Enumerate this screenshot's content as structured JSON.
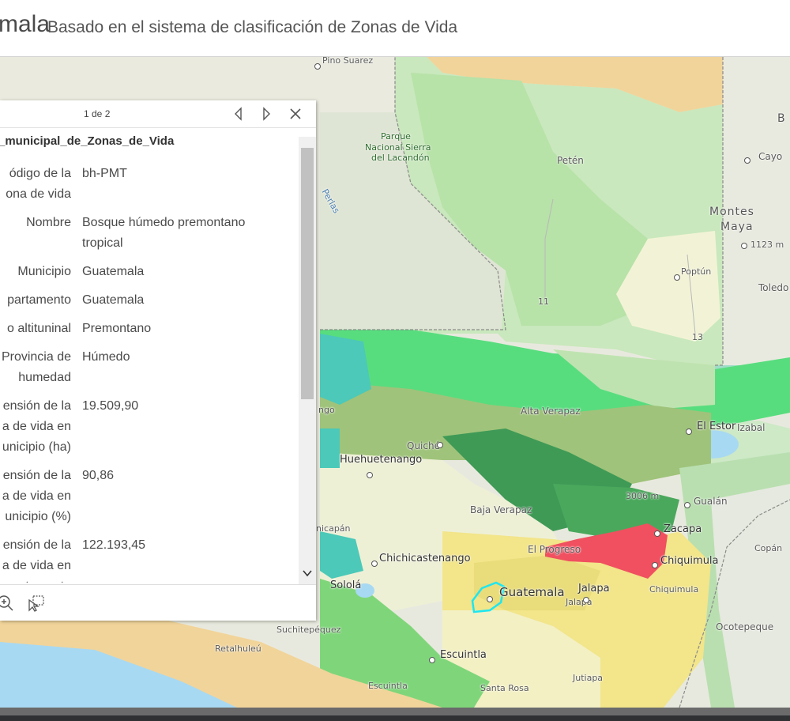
{
  "header": {
    "title": "mala",
    "subtitle": "Basado en el sistema de clasificación de Zonas de Vida"
  },
  "map": {
    "labels": {
      "pino_suarez": "Pino Suarez",
      "parque_1": "Parque",
      "parque_2": "Nacional Sierra",
      "parque_3": "del Lacandón",
      "peten": "Petén",
      "montes": "Montes",
      "maya": "Maya",
      "elev_1123": "1123 m",
      "poptun": "Poptún",
      "toledo": "Toledo",
      "cayo": "Cayo",
      "b": "B",
      "perlas": "Perlas",
      "route_11": "11",
      "route_13": "13",
      "alta_verapaz": "Alta Verapaz",
      "el_estor": "El Estor",
      "izabal": "Izabal",
      "ngo": "ngo",
      "quiche": "Quiché",
      "huehuetenango": "Huehuetenango",
      "elev_3006": "3006 m",
      "gualan": "Gualán",
      "baja_verapaz": "Baja Verapaz",
      "zacapa": "Zacapa",
      "nicapan": "nicapán",
      "el_progreso": "El Progreso",
      "chiquimula_city": "Chiquimula",
      "chichicastenango": "Chichicastenango",
      "copan": "Copán",
      "solola": "Sololá",
      "guatemala": "Guatemala",
      "jalapa_city": "Jalapa",
      "jalapa_dept": "Jalapa",
      "chiquimula_dept": "Chiquimula",
      "ocotepeque": "Ocotepeque",
      "suchitepequez": "Suchitepéquez",
      "retalhuleu": "Retalhuleú",
      "escuintla_city": "Escuintla",
      "escuintla_dept": "Escuintla",
      "jutiapa": "Jutiapa",
      "santa_rosa": "Santa Rosa"
    }
  },
  "popup": {
    "count": "1 de 2",
    "title": "_municipal_de_Zonas_de_Vida",
    "fields": [
      {
        "key_lines": [
          "ódigo de la",
          "ona de vida"
        ],
        "value_lines": [
          "bh-PMT"
        ]
      },
      {
        "key_lines": [
          "Nombre"
        ],
        "value_lines": [
          "Bosque húmedo premontano",
          "tropical"
        ]
      },
      {
        "key_lines": [
          "Municipio"
        ],
        "value_lines": [
          "Guatemala"
        ]
      },
      {
        "key_lines": [
          "partamento"
        ],
        "value_lines": [
          "Guatemala"
        ]
      },
      {
        "key_lines": [
          "o altituninal"
        ],
        "value_lines": [
          "Premontano"
        ]
      },
      {
        "key_lines": [
          "Provincia de",
          "humedad"
        ],
        "value_lines": [
          "Húmedo"
        ]
      },
      {
        "key_lines": [
          "ensión de la",
          "a de vida en",
          "unicipio (ha)"
        ],
        "value_lines": [
          "19.509,90"
        ]
      },
      {
        "key_lines": [
          "ensión de la",
          "a de vida en",
          "unicipio (%)"
        ],
        "value_lines": [
          "90,86"
        ]
      },
      {
        "key_lines": [
          "ensión de la",
          "a de vida en",
          "partamento"
        ],
        "value_lines": [
          "122.193,45"
        ]
      }
    ]
  },
  "icons": {
    "prev": "chevron-left-icon",
    "next": "chevron-right-icon",
    "close": "close-icon",
    "zoom": "zoom-in-icon",
    "select": "select-feature-icon",
    "filter": "filter-icon",
    "scroll_down": "chevron-down-icon"
  },
  "colors": {
    "zone_light_green": "#bfe3b0",
    "zone_green": "#7fd67a",
    "zone_bright_green": "#4fdc7a",
    "zone_olive": "#9bbf73",
    "zone_dark_green": "#3f9a56",
    "zone_yellow": "#f2e58a",
    "zone_pale_yellow": "#f3f0c4",
    "zone_red": "#f05060",
    "zone_teal": "#4cc9b8",
    "zone_orange": "#f1d49a",
    "selection_outline": "#1ee6f0"
  }
}
